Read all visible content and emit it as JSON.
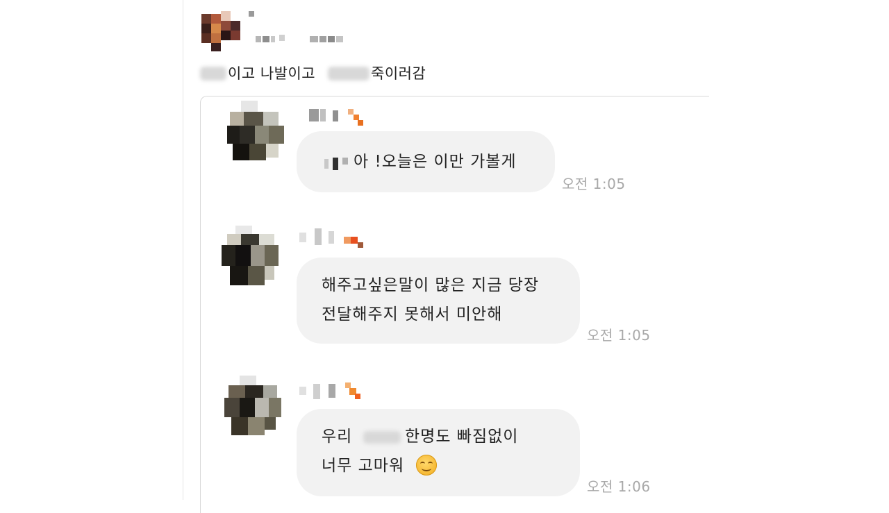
{
  "post": {
    "text_a": "이고 나발이고",
    "text_b": "죽이러감"
  },
  "messages": [
    {
      "lines": [
        "아 !오늘은 이만 가볼게"
      ],
      "time": "오전 1:05"
    },
    {
      "lines": [
        "해주고싶은말이 많은 지금 당장",
        "전달해주지 못해서 미안해"
      ],
      "time": "오전 1:05"
    },
    {
      "lines": [
        "우리",
        "한명도 빠짐없이",
        "너무 고마워"
      ],
      "time": "오전 1:06",
      "emoji": "smiling-face-emoji"
    }
  ]
}
